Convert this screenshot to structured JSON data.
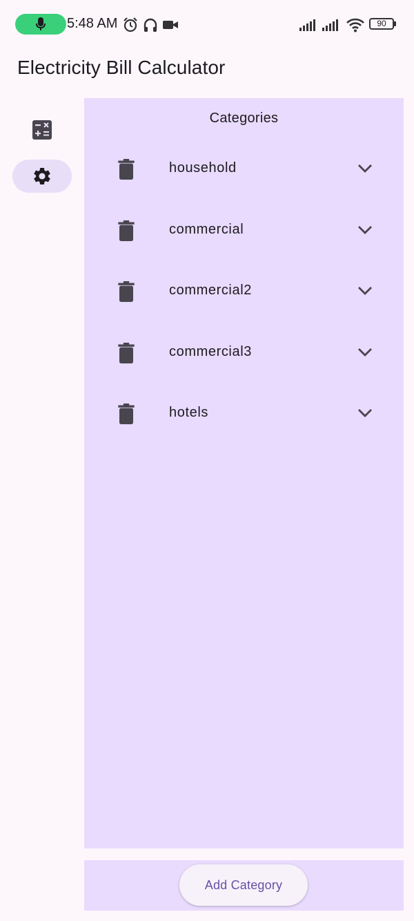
{
  "status_bar": {
    "time": "5:48 AM",
    "battery": "90",
    "icons": [
      "mic-icon",
      "alarm-icon",
      "headphones-icon",
      "video-camera-icon",
      "signal-icon",
      "signal-icon",
      "wifi-icon",
      "battery-icon"
    ]
  },
  "app_bar": {
    "title": "Electricity Bill Calculator"
  },
  "nav_rail": {
    "items": [
      {
        "icon": "calculator-icon",
        "active": false
      },
      {
        "icon": "settings-gear-icon",
        "active": true
      }
    ]
  },
  "categories": {
    "heading": "Categories",
    "items": [
      {
        "label": "household"
      },
      {
        "label": "commercial"
      },
      {
        "label": "commercial2"
      },
      {
        "label": "commercial3"
      },
      {
        "label": "hotels"
      }
    ]
  },
  "bottom_bar": {
    "add_label": "Add Category"
  },
  "colors": {
    "background": "#fdf7fc",
    "panel": "#e8dbfd",
    "rail_active": "#e8def8",
    "icon": "#49454f",
    "accent": "#6750a4",
    "mic_pill": "#3ad07a"
  }
}
